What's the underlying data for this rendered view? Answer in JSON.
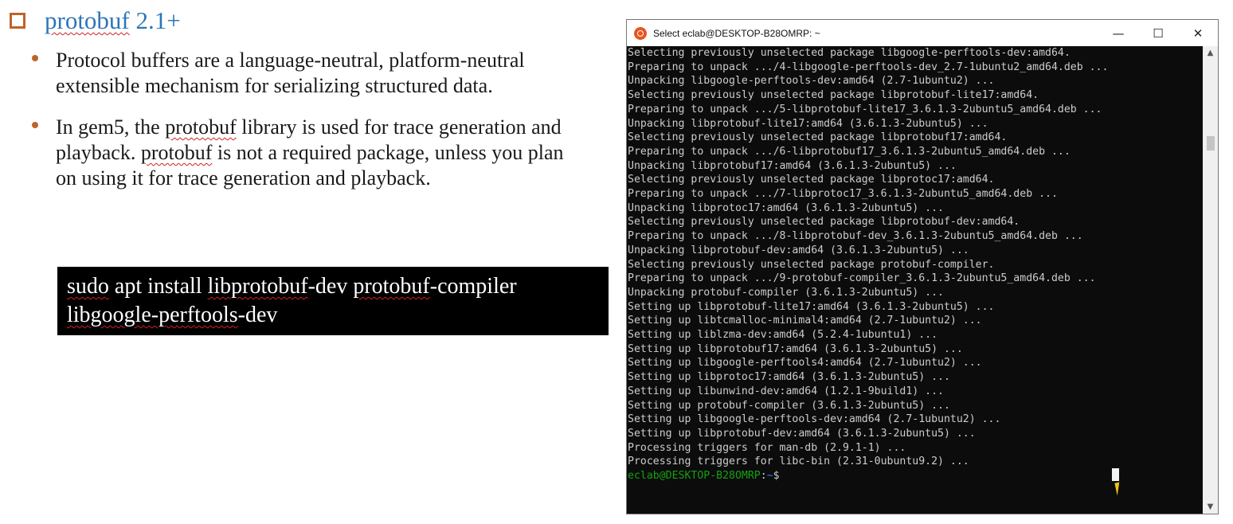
{
  "slide": {
    "title_word": "protobuf",
    "title_rest": " 2.1+",
    "bullet1": "Protocol buffers are a language-neutral, platform-neutral extensible mechanism for serializing structured data.",
    "bullet2_a": "In gem5, the ",
    "bullet2_b": "protobuf",
    "bullet2_c": " library is used for trace generation and playback. ",
    "bullet2_d": "protobuf",
    "bullet2_e": " is not a required package, unless you plan on using it for trace generation and playback.",
    "command": {
      "w1": "sudo",
      "t1": " apt install ",
      "w2": "libprotobuf",
      "t2": "-dev ",
      "w3": "protobuf",
      "t3": "-compiler ",
      "w4": "libgoogle-perftools",
      "t4": "-dev"
    }
  },
  "terminal": {
    "window_title": "Select eclab@DESKTOP-B28OMRP: ~",
    "minimize_label": "—",
    "maximize_label": "☐",
    "close_label": "✕",
    "lines": [
      "Selecting previously unselected package libgoogle-perftools-dev:amd64.",
      "Preparing to unpack .../4-libgoogle-perftools-dev_2.7-1ubuntu2_amd64.deb ...",
      "Unpacking libgoogle-perftools-dev:amd64 (2.7-1ubuntu2) ...",
      "Selecting previously unselected package libprotobuf-lite17:amd64.",
      "Preparing to unpack .../5-libprotobuf-lite17_3.6.1.3-2ubuntu5_amd64.deb ...",
      "Unpacking libprotobuf-lite17:amd64 (3.6.1.3-2ubuntu5) ...",
      "Selecting previously unselected package libprotobuf17:amd64.",
      "Preparing to unpack .../6-libprotobuf17_3.6.1.3-2ubuntu5_amd64.deb ...",
      "Unpacking libprotobuf17:amd64 (3.6.1.3-2ubuntu5) ...",
      "Selecting previously unselected package libprotoc17:amd64.",
      "Preparing to unpack .../7-libprotoc17_3.6.1.3-2ubuntu5_amd64.deb ...",
      "Unpacking libprotoc17:amd64 (3.6.1.3-2ubuntu5) ...",
      "Selecting previously unselected package libprotobuf-dev:amd64.",
      "Preparing to unpack .../8-libprotobuf-dev_3.6.1.3-2ubuntu5_amd64.deb ...",
      "Unpacking libprotobuf-dev:amd64 (3.6.1.3-2ubuntu5) ...",
      "Selecting previously unselected package protobuf-compiler.",
      "Preparing to unpack .../9-protobuf-compiler_3.6.1.3-2ubuntu5_amd64.deb ...",
      "Unpacking protobuf-compiler (3.6.1.3-2ubuntu5) ...",
      "Setting up libprotobuf-lite17:amd64 (3.6.1.3-2ubuntu5) ...",
      "Setting up libtcmalloc-minimal4:amd64 (2.7-1ubuntu2) ...",
      "Setting up liblzma-dev:amd64 (5.2.4-1ubuntu1) ...",
      "Setting up libprotobuf17:amd64 (3.6.1.3-2ubuntu5) ...",
      "Setting up libgoogle-perftools4:amd64 (2.7-1ubuntu2) ...",
      "Setting up libprotoc17:amd64 (3.6.1.3-2ubuntu5) ...",
      "Setting up libunwind-dev:amd64 (1.2.1-9build1) ...",
      "Setting up protobuf-compiler (3.6.1.3-2ubuntu5) ...",
      "Setting up libgoogle-perftools-dev:amd64 (2.7-1ubuntu2) ...",
      "Setting up libprotobuf-dev:amd64 (3.6.1.3-2ubuntu5) ...",
      "Processing triggers for man-db (2.9.1-1) ...",
      "Processing triggers for libc-bin (2.31-0ubuntu9.2) ..."
    ],
    "prompt_user": "eclab@DESKTOP-B28OMRP",
    "prompt_sep": ":",
    "prompt_path": "~",
    "prompt_symbol": "$"
  },
  "colors": {
    "title_blue": "#2e75b6",
    "accent_orange": "#c0622a",
    "spellcheck_red": "#d02020",
    "terminal_bg": "#0c0c0c",
    "prompt_green": "#13a10e",
    "prompt_blue": "#3b78ff"
  },
  "icons": [
    "checkbox-icon",
    "ubuntu-icon",
    "minimize-icon",
    "maximize-icon",
    "close-icon",
    "scroll-up-icon",
    "scroll-down-icon",
    "mouse-pointer-icon"
  ]
}
